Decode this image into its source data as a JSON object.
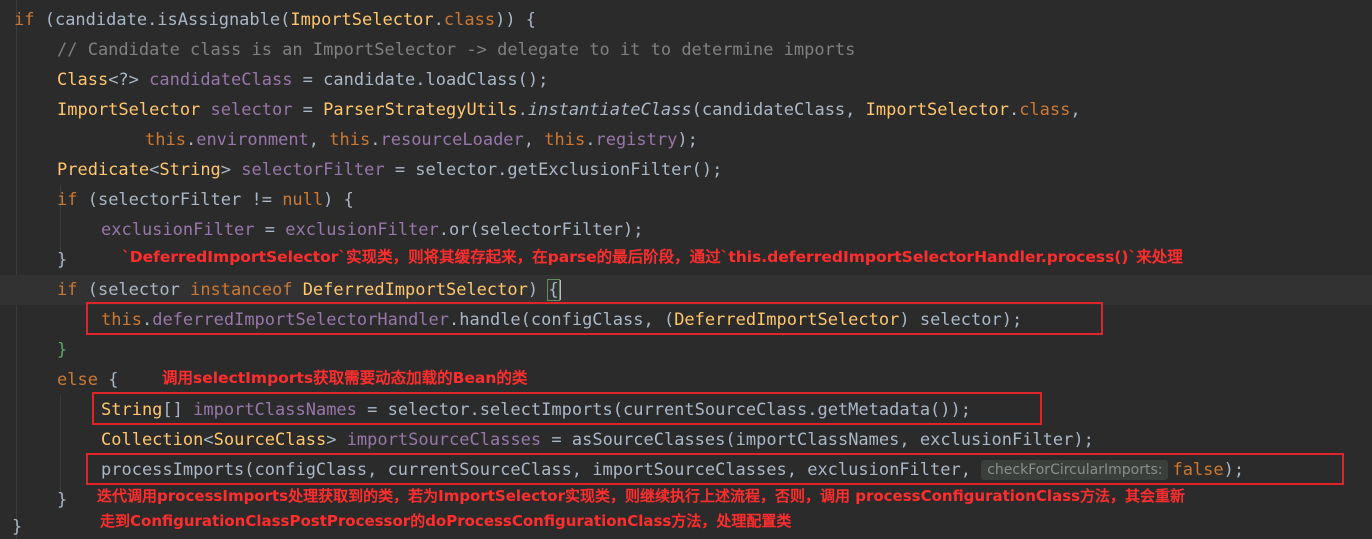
{
  "code": {
    "l1": {
      "kw1": "if",
      "p1": " (candidate.isAssignable(",
      "cls1": "ImportSelector",
      "p2": ".",
      "kw2": "class",
      "p3": ")) {"
    },
    "l2": {
      "comment": "// Candidate class is an ImportSelector -> delegate to it to determine imports"
    },
    "l3": {
      "cls1": "Class",
      "p1": "<?> ",
      "var1": "candidateClass",
      "p2": " = candidate.loadClass();"
    },
    "l4": {
      "cls1": "ImportSelector",
      "p1": " ",
      "var1": "selector",
      "p2": " = ",
      "cls2": "ParserStrategyUtils",
      "p3": ".",
      "fn1": "instantiateClass",
      "p4": "(candidateClass, ",
      "cls3": "ImportSelector",
      "p5": ".",
      "kw1": "class",
      "p6": ","
    },
    "l5": {
      "kw1": "this",
      "p1": ".",
      "fld1": "environment",
      "p2": ", ",
      "kw2": "this",
      "p3": ".",
      "fld2": "resourceLoader",
      "p4": ", ",
      "kw3": "this",
      "p5": ".",
      "fld3": "registry",
      "p6": ");"
    },
    "l6": {
      "cls1": "Predicate",
      "p1": "<",
      "cls2": "String",
      "p2": "> ",
      "var1": "selectorFilter",
      "p3": " = selector.getExclusionFilter();"
    },
    "l7": {
      "kw1": "if",
      "p1": " (selectorFilter != ",
      "kw2": "null",
      "p2": ") {"
    },
    "l8": {
      "var1": "exclusionFilter",
      "p1": " = ",
      "var2": "exclusionFilter",
      "p2": ".or(selectorFilter);"
    },
    "l9": {
      "p1": "}"
    },
    "l10": {
      "kw1": "if",
      "p1": " (selector ",
      "kw2": "instanceof",
      "p2": " ",
      "cls1": "DeferredImportSelector",
      "p3": ") ",
      "brace": "{"
    },
    "l11": {
      "kw1": "this",
      "p1": ".",
      "fld1": "deferredImportSelectorHandler",
      "p2": ".handle(configClass, (",
      "cls1": "DeferredImportSelector",
      "p3": ") selector);"
    },
    "l12": {
      "brace": "}"
    },
    "l13": {
      "kw1": "else",
      "p1": " {"
    },
    "l14": {
      "cls1": "String",
      "p1": "[] ",
      "var1": "importClassNames",
      "p2": " = selector.selectImports(currentSourceClass.getMetadata());"
    },
    "l15": {
      "cls1": "Collection",
      "p1": "<",
      "cls2": "SourceClass",
      "p2": "> ",
      "var1": "importSourceClasses",
      "p3": " = asSourceClasses(importClassNames, exclusionFilter);"
    },
    "l16": {
      "p1": "processImports(configClass, currentSourceClass, importSourceClasses, exclusionFilter, ",
      "hint": "checkForCircularImports:",
      "kw1": "false",
      "p2": ");"
    },
    "l17": {
      "p1": "}"
    },
    "l18": {
      "p1": "}"
    }
  },
  "annotations": {
    "note1": "`DeferredImportSelector`实现类，则将其缓存起来，在parse的最后阶段，通过`this.deferredImportSelectorHandler.process()`来处理",
    "note2": "调用selectImports获取需要动态加载的Bean的类",
    "note3a": "迭代调用processImports处理获取到的类，若为ImportSelector实现类，则继续执行上述流程，否则，调用 processConfigurationClass方法，其会重新",
    "note3b": "走到ConfigurationClassPostProcessor的doProcessConfigurationClass方法，处理配置类"
  },
  "colors": {
    "background": "#2b2b2b",
    "keyword": "#cc7832",
    "class": "#ffc66d",
    "field": "#9876aa",
    "comment": "#808080",
    "text": "#a9b7c6",
    "annotation": "#ff2d2d",
    "box": "#e0242a"
  }
}
